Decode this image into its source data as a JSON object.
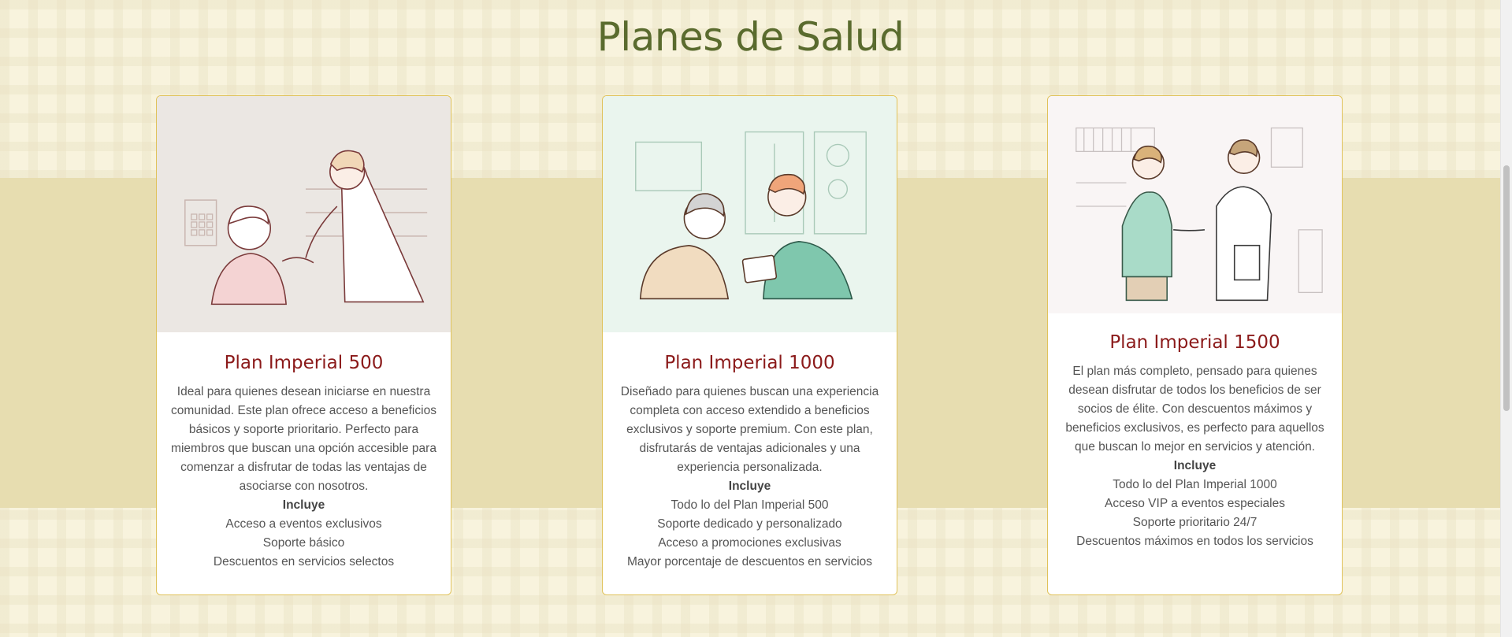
{
  "page": {
    "title": "Planes de Salud"
  },
  "plans": [
    {
      "title": "Plan Imperial 500",
      "description": "Ideal para quienes desean iniciarse en nuestra comunidad. Este plan ofrece acceso a beneficios básicos y soporte prioritario. Perfecto para miembros que buscan una opción accesible para comenzar a disfrutar de todas las ventajas de asociarse con nosotros.",
      "includes_label": "Incluye",
      "features": [
        "Acceso a eventos exclusivos",
        "Soporte básico",
        "Descuentos en servicios selectos"
      ],
      "image": "doctor-elderly-woman-illustration"
    },
    {
      "title": "Plan Imperial 1000",
      "description": "Diseñado para quienes buscan una experiencia completa con acceso extendido a beneficios exclusivos y soporte premium. Con este plan, disfrutarás de ventajas adicionales y una experiencia personalizada.",
      "includes_label": "Incluye",
      "features": [
        "Todo lo del Plan Imperial 500",
        "Soporte dedicado y personalizado",
        "Acceso a promociones exclusivas",
        "Mayor porcentaje de descuentos en servicios"
      ],
      "image": "doctor-tablet-patient-illustration"
    },
    {
      "title": "Plan Imperial 1500",
      "description": "El plan más completo, pensado para quienes desean disfrutar de todos los beneficios de ser socios de élite. Con descuentos máximos y beneficios exclusivos, es perfecto para aquellos que buscan lo mejor en servicios y atención.",
      "includes_label": "Incluye",
      "features": [
        "Todo lo del Plan Imperial 1000",
        "Acceso VIP a eventos especiales",
        "Soporte prioritario 24/7",
        "Descuentos máximos en todos los servicios"
      ],
      "image": "doctor-handshake-illustration"
    }
  ],
  "colors": {
    "title": "#5a6b2e",
    "card_title": "#8b1a1a",
    "band": "#e7ddb0",
    "card_border": "#e0c25a"
  }
}
